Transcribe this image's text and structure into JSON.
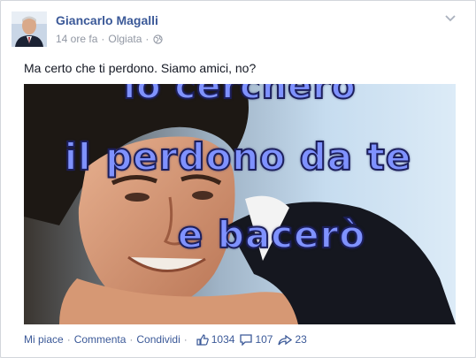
{
  "post": {
    "author": "Giancarlo Magalli",
    "time": "14 ore fa",
    "separator": "·",
    "location": "Olgiata",
    "text": "Ma certo che ti perdono. Siamo amici, no?"
  },
  "media": {
    "lyrics": [
      "io cercherò",
      "il perdono da te",
      "e bacerò"
    ]
  },
  "actions": {
    "like": "Mi piace",
    "comment": "Commenta",
    "share": "Condividi",
    "dot": "·",
    "likes_count": "1034",
    "comments_count": "107",
    "shares_count": "23"
  },
  "icons": {
    "privacy": "globe-icon",
    "menu": "chevron-down-icon",
    "likes": "thumbs-up-icon",
    "comments": "comment-icon",
    "shares": "share-arrow-icon"
  },
  "colors": {
    "link": "#3b5998",
    "meta": "#9197a3",
    "text": "#141823",
    "lyric_fill": "#7f92ff",
    "lyric_outline": "#1c1f5c"
  }
}
